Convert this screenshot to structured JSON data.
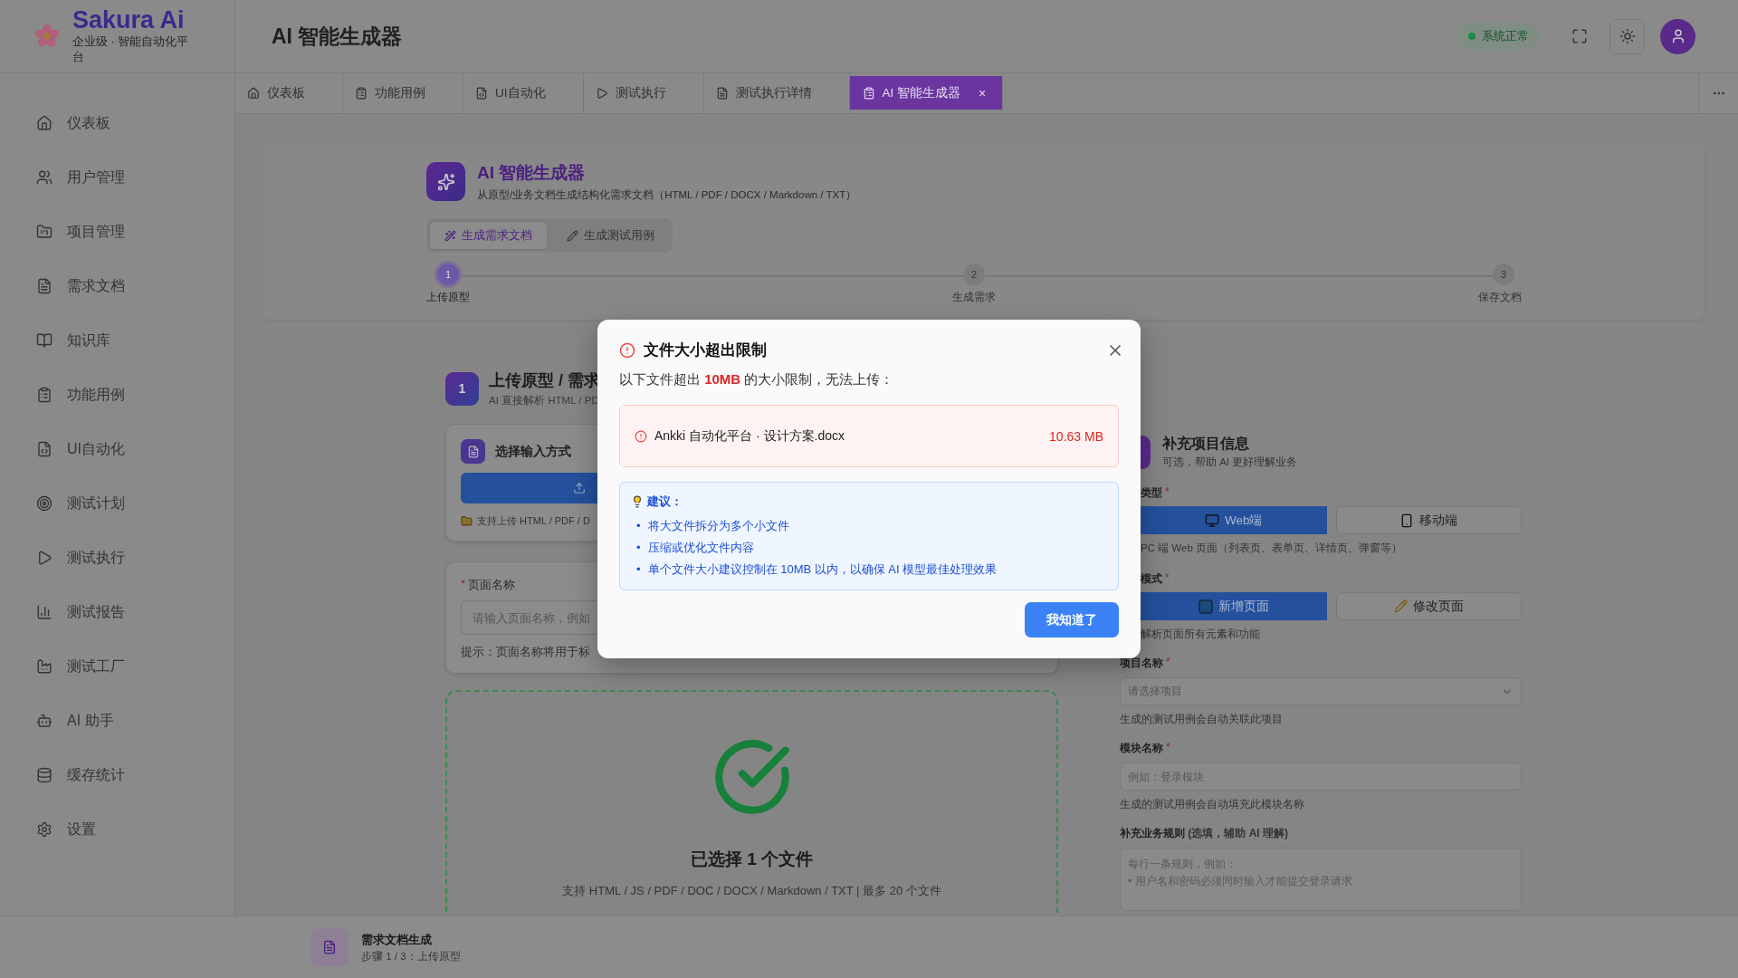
{
  "brand": {
    "name": "Sakura Ai",
    "tagline": "企业级 · 智能自动化平台"
  },
  "page_title": "AI 智能生成器",
  "header": {
    "status": "系统正常"
  },
  "sidebar": {
    "items": [
      {
        "label": "仪表板"
      },
      {
        "label": "用户管理"
      },
      {
        "label": "项目管理"
      },
      {
        "label": "需求文档"
      },
      {
        "label": "知识库"
      },
      {
        "label": "功能用例"
      },
      {
        "label": "UI自动化"
      },
      {
        "label": "测试计划"
      },
      {
        "label": "测试执行"
      },
      {
        "label": "测试报告"
      },
      {
        "label": "测试工厂"
      },
      {
        "label": "AI 助手"
      },
      {
        "label": "缓存统计"
      },
      {
        "label": "设置"
      }
    ]
  },
  "tabs": [
    {
      "label": "仪表板",
      "selected": false
    },
    {
      "label": "功能用例",
      "selected": false
    },
    {
      "label": "UI自动化",
      "selected": false
    },
    {
      "label": "测试执行",
      "selected": false
    },
    {
      "label": "测试执行详情",
      "selected": false
    },
    {
      "label": "AI 智能生成器",
      "selected": true,
      "close": "×"
    }
  ],
  "hero": {
    "title": "AI 智能生成器",
    "subtitle": "从原型/业务文档生成结构化需求文档（HTML / PDF / DOCX / Markdown / TXT）",
    "modes": [
      {
        "label": "生成需求文档",
        "selected": true
      },
      {
        "label": "生成测试用例",
        "selected": false
      }
    ],
    "steps": [
      {
        "number": "1",
        "label": "上传原型",
        "selected": true
      },
      {
        "number": "2",
        "label": "生成需求",
        "selected": false
      },
      {
        "number": "3",
        "label": "保存文档",
        "selected": false
      }
    ]
  },
  "upload_card": {
    "number": "1",
    "title": "上传原型 / 需求",
    "subtitle": "AI 直接解析 HTML / PD",
    "input_method": {
      "title": "选择输入方式",
      "note": "支持上传 HTML / PDF / D"
    },
    "page_name": {
      "label": "页面名称",
      "mark": "*",
      "placeholder": "请输入页面名称，例如",
      "hint": "提示：页面名称将用于标"
    },
    "dropzone": {
      "title": "已选择 1 个文件",
      "subtitle": "支持 HTML / JS / PDF / DOC / DOCX / Markdown / TXT | 最多 20 个文件"
    }
  },
  "project_info": {
    "title": "补充项目信息",
    "subtitle": "可选，帮助 AI 更好理解业务",
    "fields": [
      {
        "kind": "choice",
        "label": "类型",
        "mark": "*",
        "options": [
          {
            "label": "Web端",
            "selected": true
          },
          {
            "label": "移动端",
            "selected": false
          }
        ],
        "hint": "PC 端 Web 页面（列表页、表单页、详情页、弹窗等）"
      },
      {
        "kind": "choice",
        "label": "模式",
        "mark": "*",
        "options": [
          {
            "label": "新增页面",
            "selected": true
          },
          {
            "label": "修改页面",
            "selected": false
          }
        ],
        "hint": "解析页面所有元素和功能"
      },
      {
        "kind": "select",
        "label": "项目名称",
        "mark": "*",
        "placeholder": "请选择项目",
        "hint": "生成的测试用例会自动关联此项目"
      },
      {
        "kind": "text",
        "label": "模块名称",
        "mark": "*",
        "placeholder": "例如：登录模块",
        "hint": "生成的测试用例会自动填充此模块名称"
      },
      {
        "kind": "textarea",
        "label": "**补充业务规则** (选填，辅助 AI 理解)",
        "placeholder": "每行一条规则，例如：\n• 用户名和密码必须同时输入才能提交登录请求"
      }
    ]
  },
  "bottom_bar": {
    "title": "需求文档生成",
    "subtitle": "步骤 1 / 3：上传原型"
  },
  "dialog": {
    "title": "文件大小超出限制",
    "message": "以下文件超出 **10MB** 的大小限制，无法上传：",
    "files": [
      {
        "name": "Ankki 自动化平台 · 设计方案.docx",
        "size": "10.63 MB"
      }
    ],
    "tips": {
      "title": "建议：",
      "bullet": "•",
      "items": [
        "将大文件拆分为多个小文件",
        "压缩或优化文件内容",
        "单个文件大小建议控制在 10MB 以内，以确保 AI 模型最佳处理效果"
      ]
    },
    "button": "我知道了"
  }
}
